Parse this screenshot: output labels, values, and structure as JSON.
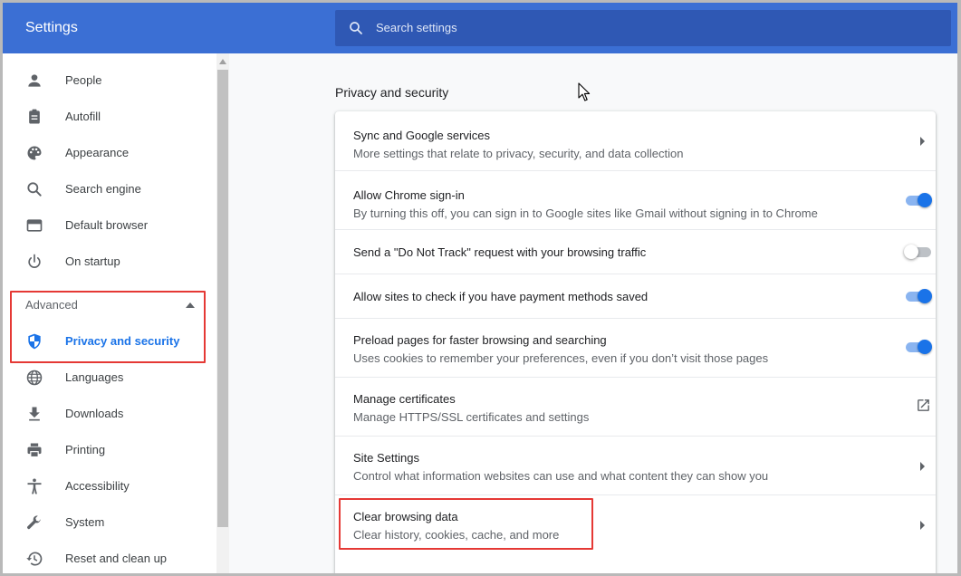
{
  "header": {
    "title": "Settings",
    "search_placeholder": "Search settings"
  },
  "sidebar": {
    "items": [
      {
        "label": "People",
        "icon": "person-icon"
      },
      {
        "label": "Autofill",
        "icon": "clipboard-icon"
      },
      {
        "label": "Appearance",
        "icon": "palette-icon"
      },
      {
        "label": "Search engine",
        "icon": "search-icon"
      },
      {
        "label": "Default browser",
        "icon": "browser-window-icon"
      },
      {
        "label": "On startup",
        "icon": "power-icon"
      }
    ],
    "advanced_label": "Advanced",
    "advanced_items": [
      {
        "label": "Privacy and security",
        "icon": "shield-icon",
        "active": true
      },
      {
        "label": "Languages",
        "icon": "globe-icon"
      },
      {
        "label": "Downloads",
        "icon": "download-icon"
      },
      {
        "label": "Printing",
        "icon": "printer-icon"
      },
      {
        "label": "Accessibility",
        "icon": "accessibility-icon"
      },
      {
        "label": "System",
        "icon": "wrench-icon"
      },
      {
        "label": "Reset and clean up",
        "icon": "history-icon"
      }
    ]
  },
  "main": {
    "section_title": "Privacy and security",
    "rows": [
      {
        "title": "Sync and Google services",
        "subtitle": "More settings that relate to privacy, security, and data collection",
        "control": "chevron"
      },
      {
        "title": "Allow Chrome sign-in",
        "subtitle": "By turning this off, you can sign in to Google sites like Gmail without signing in to Chrome",
        "control": "toggle",
        "on": true
      },
      {
        "title": "Send a \"Do Not Track\" request with your browsing traffic",
        "control": "toggle",
        "on": false
      },
      {
        "title": "Allow sites to check if you have payment methods saved",
        "control": "toggle",
        "on": true
      },
      {
        "title": "Preload pages for faster browsing and searching",
        "subtitle": "Uses cookies to remember your preferences, even if you don’t visit those pages",
        "control": "toggle",
        "on": true
      },
      {
        "title": "Manage certificates",
        "subtitle": "Manage HTTPS/SSL certificates and settings",
        "control": "external-link"
      },
      {
        "title": "Site Settings",
        "subtitle": "Control what information websites can use and what content they can show you",
        "control": "chevron"
      },
      {
        "title": "Clear browsing data",
        "subtitle": "Clear history, cookies, cache, and more",
        "control": "chevron"
      }
    ]
  },
  "colors": {
    "header_bg": "#3b6fd4",
    "search_bg": "#2f58b4",
    "accent": "#1a73e8",
    "highlight_border": "#e53935"
  }
}
